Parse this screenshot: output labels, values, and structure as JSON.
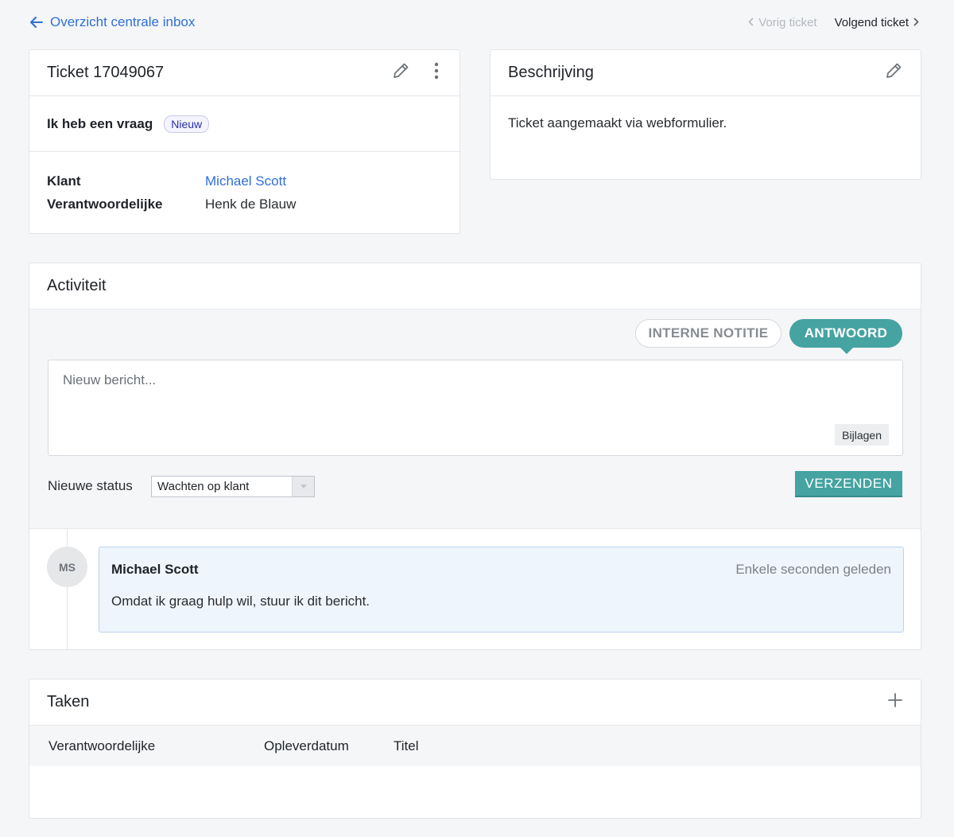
{
  "nav": {
    "back_label": "Overzicht centrale inbox",
    "prev_label": "Vorig ticket",
    "next_label": "Volgend ticket"
  },
  "ticket": {
    "title": "Ticket 17049067",
    "subject": "Ik heb een vraag",
    "status_badge": "Nieuw",
    "fields": [
      {
        "key": "Klant",
        "value": "Michael Scott"
      },
      {
        "key": "Verantwoordelijke",
        "value": "Henk de Blauw"
      }
    ]
  },
  "description": {
    "title": "Beschrijving",
    "text": "Ticket aangemaakt via webformulier."
  },
  "activity": {
    "title": "Activiteit",
    "mode_internal": "INTERNE NOTITIE",
    "mode_reply": "ANTWOORD",
    "message_placeholder": "Nieuw bericht...",
    "attach_label": "Bijlagen",
    "status_label": "Nieuwe status",
    "status_value": "Wachten op klant",
    "send_label": "VERZENDEN",
    "messages": [
      {
        "initials": "MS",
        "author": "Michael Scott",
        "time": "Enkele seconden geleden",
        "text": "Omdat ik graag hulp wil, stuur ik dit bericht."
      }
    ]
  },
  "tasks": {
    "title": "Taken",
    "columns": [
      "Verantwoordelijke",
      "Opleverdatum",
      "Titel"
    ]
  },
  "colors": {
    "accent": "#45a3a1",
    "link": "#2f6fd8",
    "background": "#f5f6f8"
  }
}
